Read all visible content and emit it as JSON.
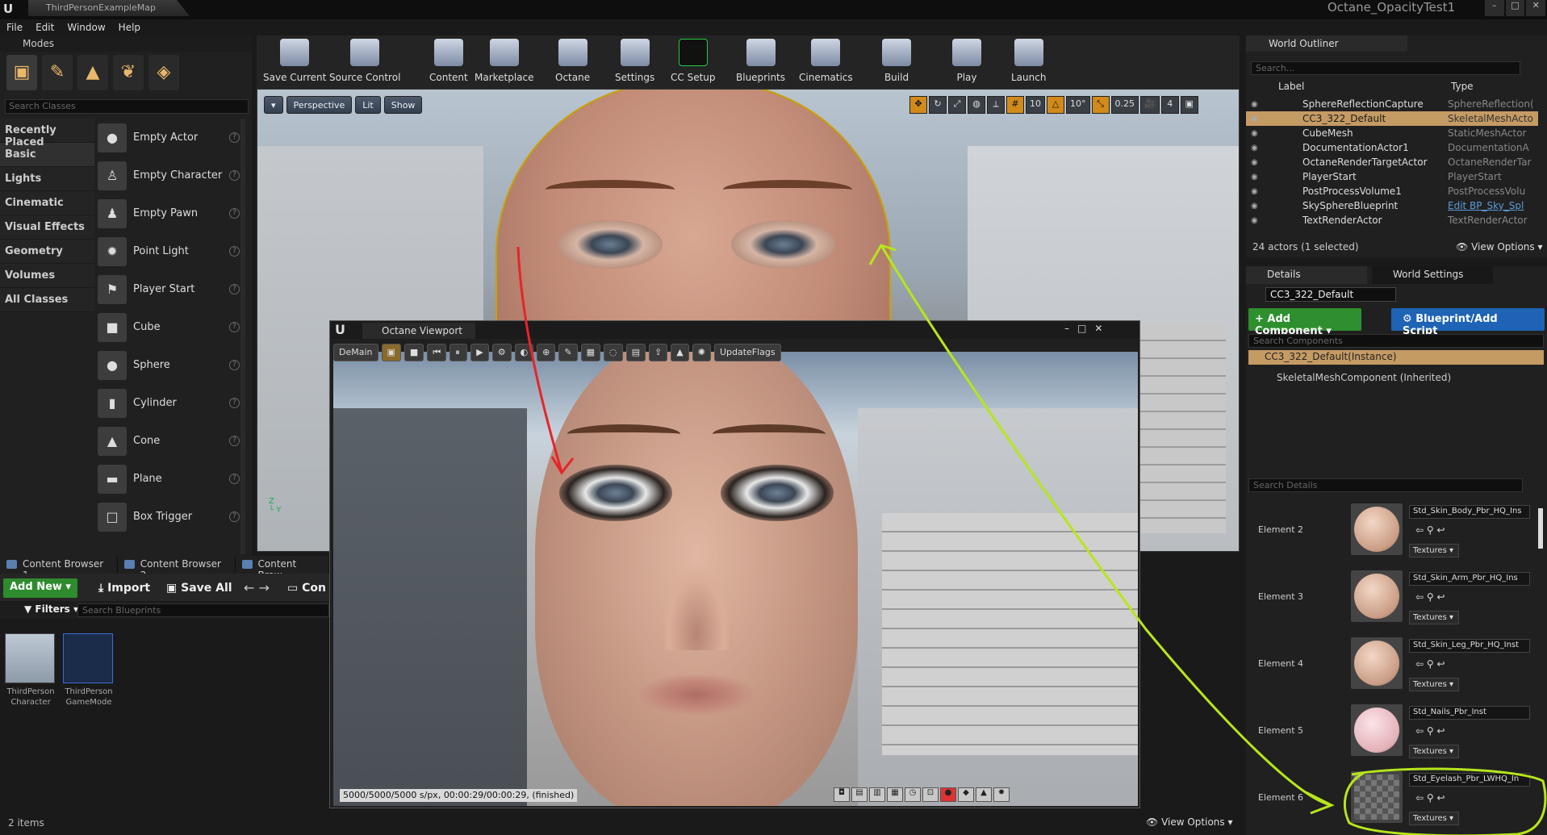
{
  "app": {
    "map_tab": "ThirdPersonExampleMap",
    "project_name": "Octane_OpacityTest1",
    "menu": [
      "File",
      "Edit",
      "Window",
      "Help"
    ]
  },
  "modes": {
    "title": "Modes",
    "search_placeholder": "Search Classes",
    "categories": [
      "Recently Placed",
      "Basic",
      "Lights",
      "Cinematic",
      "Visual Effects",
      "Geometry",
      "Volumes",
      "All Classes"
    ],
    "active_category": "Basic",
    "classes": [
      "Empty Actor",
      "Empty Character",
      "Empty Pawn",
      "Point Light",
      "Player Start",
      "Cube",
      "Sphere",
      "Cylinder",
      "Cone",
      "Plane",
      "Box Trigger"
    ]
  },
  "toolbar": {
    "buttons": [
      "Save Current",
      "Source Control",
      "Content",
      "Marketplace",
      "Octane",
      "Settings",
      "CC Setup",
      "Blueprints",
      "Cinematics",
      "Build",
      "Play",
      "Launch"
    ]
  },
  "viewport": {
    "perspective": "Perspective",
    "lit": "Lit",
    "show": "Show",
    "grid_snap": "10",
    "rotation_snap": "10°",
    "scale_snap": "0.25",
    "camera_speed": "4"
  },
  "octane_viewport": {
    "title": "Octane Viewport",
    "demain": "DeMain",
    "update_flags": "UpdateFlags",
    "status": "5000/5000/5000 s/px, 00:00:29/00:00:29, (finished)"
  },
  "content_browser": {
    "tabs": [
      "Content Browser 1",
      "Content Browser 2",
      "Content Brow"
    ],
    "add_new": "Add New",
    "import": "Import",
    "save_all": "Save All",
    "path_label": "Con",
    "filters": "Filters",
    "search_placeholder": "Search Blueprints",
    "assets": [
      {
        "line1": "ThirdPerson",
        "line2": "Character"
      },
      {
        "line1": "ThirdPerson",
        "line2": "GameMode"
      }
    ],
    "items_count": "2 items",
    "view_options": "View Options"
  },
  "outliner": {
    "title": "World Outliner",
    "search_placeholder": "Search...",
    "col_label": "Label",
    "col_type": "Type",
    "rows": [
      {
        "label": "SphereReflectionCapture",
        "type": "SphereReflection("
      },
      {
        "label": "CC3_322_Default",
        "type": "SkeletalMeshActo"
      },
      {
        "label": "CubeMesh",
        "type": "StaticMeshActor"
      },
      {
        "label": "DocumentationActor1",
        "type": "DocumentationA"
      },
      {
        "label": "OctaneRenderTargetActor",
        "type": "OctaneRenderTar"
      },
      {
        "label": "PlayerStart",
        "type": "PlayerStart"
      },
      {
        "label": "PostProcessVolume1",
        "type": "PostProcessVolu"
      },
      {
        "label": "SkySphereBlueprint",
        "type": "Edit BP_Sky_Spl"
      },
      {
        "label": "TextRenderActor",
        "type": "TextRenderActor"
      }
    ],
    "actors_count": "24 actors (1 selected)",
    "view_options": "View Options"
  },
  "details": {
    "tab_details": "Details",
    "tab_world": "World Settings",
    "actor_name": "CC3_322_Default",
    "add_component": "+ Add Component",
    "blueprint_script": "Blueprint/Add Script",
    "search_components": "Search Components",
    "instance": "CC3_322_Default(Instance)",
    "skeletal": "SkeletalMeshComponent (Inherited)",
    "search_details": "Search Details",
    "elements": [
      {
        "label": "Element 2",
        "material": "Std_Skin_Body_Pbr_HQ_Ins",
        "textures": "Textures"
      },
      {
        "label": "Element 3",
        "material": "Std_Skin_Arm_Pbr_HQ_Ins",
        "textures": "Textures"
      },
      {
        "label": "Element 4",
        "material": "Std_Skin_Leg_Pbr_HQ_Inst",
        "textures": "Textures"
      },
      {
        "label": "Element 5",
        "material": "Std_Nails_Pbr_Inst",
        "textures": "Textures"
      },
      {
        "label": "Element 6",
        "material": "Std_Eyelash_Pbr_LWHQ_In",
        "textures": "Textures"
      }
    ]
  },
  "colors": {
    "annotation_red": "#e8232a",
    "annotation_green": "#b6e61b",
    "selection": "#c59b64",
    "add_green": "#2e8b2e",
    "blueprint_blue": "#1e63b5"
  }
}
